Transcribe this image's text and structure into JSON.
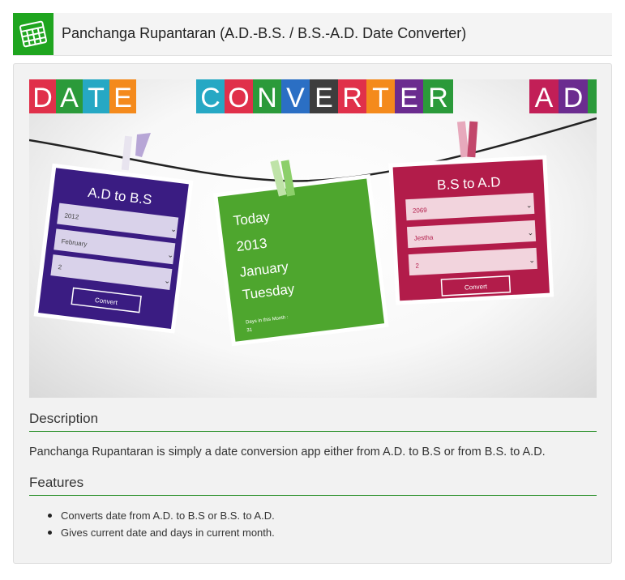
{
  "header": {
    "title": "Panchanga Rupantaran (A.D.-B.S. / B.S.-A.D. Date Converter)",
    "icon": "calendar-icon",
    "icon_color": "#1fa51f"
  },
  "banner": {
    "tiles_left": [
      "D",
      "A",
      "T",
      "E"
    ],
    "tiles_middle": [
      "C",
      "O",
      "N",
      "V",
      "E",
      "R",
      "T",
      "E",
      "R"
    ],
    "tiles_right": [
      "A",
      "D"
    ],
    "card_ad_to_bs": {
      "title": "A.D to B.S",
      "year": "2012",
      "month": "February",
      "day": "2",
      "button": "Convert",
      "color": "#3a1c82"
    },
    "card_today": {
      "line1": "Today",
      "line2": "2013",
      "line3": "January",
      "line4": "Tuesday",
      "days_label": "Days in this Month :",
      "days_value": "31",
      "color": "#4ea62e"
    },
    "card_bs_to_ad": {
      "title": "B.S to A.D",
      "year": "2069",
      "month": "Jestha",
      "day": "2",
      "button": "Convert",
      "color": "#b21c4a"
    }
  },
  "description": {
    "heading": "Description",
    "text": "Panchanga Rupantaran is simply a date conversion app either from A.D. to B.S or from B.S. to A.D."
  },
  "features": {
    "heading": "Features",
    "items": [
      "Converts date from A.D. to B.S or B.S. to A.D.",
      "Gives current date and days in current month."
    ]
  },
  "colors": {
    "accent": "#1e8a1e",
    "tile_palette": [
      "#e0304a",
      "#26a8c4",
      "#f48a1c",
      "#6b2c8f",
      "#2b9a3a",
      "#3d3d3d",
      "#c21f57"
    ]
  }
}
